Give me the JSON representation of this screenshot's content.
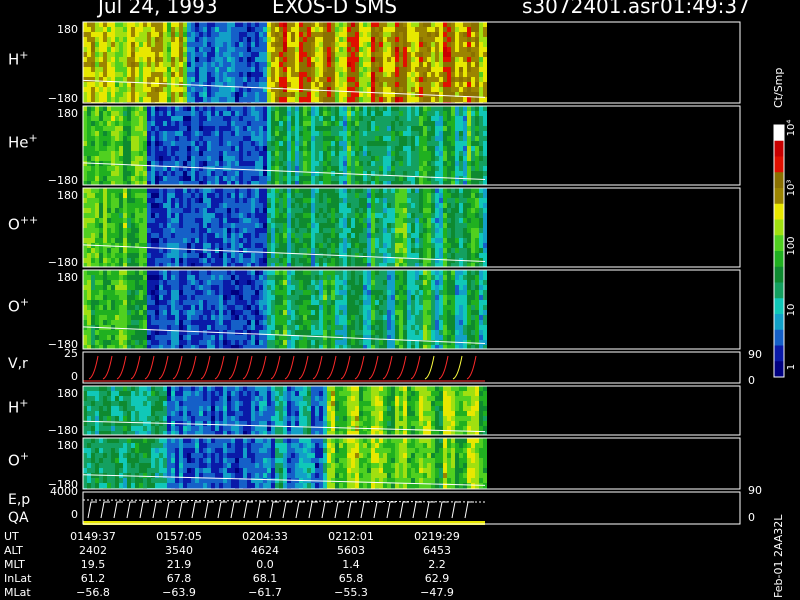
{
  "header": {
    "date": "Jul 24, 1993",
    "instrument": "EXOS-D SMS",
    "file": "s3072401.asr",
    "time": "01:49:37"
  },
  "colorbar": {
    "unit": "Ct/Smp",
    "ticks": [
      "1",
      "10",
      "100",
      "10³",
      "10⁴"
    ],
    "colors": [
      "#000080",
      "#0a1aa8",
      "#1560c8",
      "#12a0c8",
      "#10c8b8",
      "#14a060",
      "#0e8a30",
      "#20b020",
      "#50d020",
      "#a0e010",
      "#e8e800",
      "#9b8400",
      "#8a7000",
      "#e01000",
      "#c80000",
      "#ffffff"
    ]
  },
  "chart_data": {
    "type": "heatmap",
    "panels": [
      {
        "name": "H",
        "charge": "+",
        "y_top": "180",
        "y_bottom": "−180"
      },
      {
        "name": "He",
        "charge": "+",
        "y_top": "180",
        "y_bottom": "−180"
      },
      {
        "name": "O",
        "charge": "++",
        "y_top": "180",
        "y_bottom": "−180"
      },
      {
        "name": "O",
        "charge": "+",
        "y_top": "180",
        "y_bottom": "−180"
      },
      {
        "name": "V,r",
        "y_top": "25",
        "y_mid": "0",
        "right_top": "90",
        "right_bottom": "0"
      },
      {
        "name": "H",
        "charge": "+",
        "y_top": "180",
        "y_bottom": "−180"
      },
      {
        "name": "O",
        "charge": "+",
        "y_top": "180",
        "y_bottom": "−180"
      },
      {
        "name": "E,p",
        "name2": "QA",
        "y_top": "4000",
        "y_mid": "0",
        "right_top": "90",
        "right_bottom": "0"
      }
    ]
  },
  "ephemeris": {
    "labels": [
      "UT",
      "ALT",
      "MLT",
      "InLat",
      "MLat"
    ],
    "columns": [
      [
        "0149:37",
        "2402",
        "19.5",
        "61.2",
        "−56.8"
      ],
      [
        "0157:05",
        "3540",
        "21.9",
        "67.8",
        "−63.9"
      ],
      [
        "0204:33",
        "4624",
        "0.0",
        "68.1",
        "−61.7"
      ],
      [
        "0212:01",
        "5603",
        "1.4",
        "65.8",
        "−55.3"
      ],
      [
        "0219:29",
        "6453",
        "2.2",
        "62.9",
        "−47.9"
      ]
    ]
  },
  "footer_id": "Feb-01 2AA32L"
}
